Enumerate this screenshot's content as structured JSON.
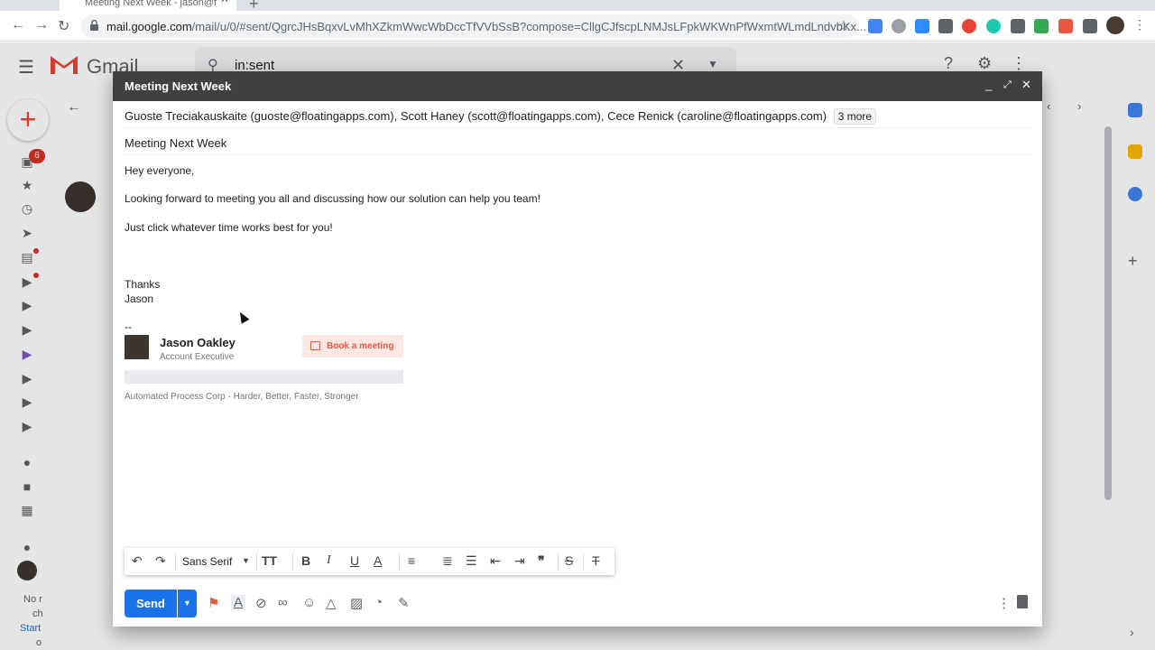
{
  "browser": {
    "tab_title": "Meeting Next Week - jason@f",
    "url_host": "mail.google.com",
    "url_path": "/mail/u/0/#sent/QgrcJHsBqxvLvMhXZkmWwcWbDccTfVVbSsB?compose=CllgCJfscpLNMJsLFpkWKWnPfWxmtWLmdLndvbKx..."
  },
  "gmail": {
    "logo_text": "Gmail",
    "search_value": "in:sent",
    "inbox_count": "6",
    "sidebar_bottom_text1": "No r",
    "sidebar_bottom_text2": "ch",
    "sidebar_bottom_link": "Start",
    "sidebar_bottom_text3": "o"
  },
  "compose": {
    "title": "Meeting Next Week",
    "recipients": "Guoste Treciakauskaite (guoste@floatingapps.com), Scott Haney (scott@floatingapps.com), Cece Renick (caroline@floatingapps.com)",
    "more_recipients": "3 more",
    "subject": "Meeting Next Week",
    "body": {
      "greeting": "Hey everyone,",
      "line1": "Looking forward to meeting you all and discussing how our solution can help you team!",
      "line2": "Just click whatever time works best for you!",
      "closing1": "Thanks",
      "closing2": "Jason",
      "sig_separator": "--"
    },
    "signature": {
      "name": "Jason Oakley",
      "title": "Account Executive",
      "book_button": "Book a meeting",
      "company": "Automated Process Corp - Harder, Better, Faster, Stronger"
    },
    "toolbar": {
      "font": "Sans Serif"
    },
    "send_label": "Send"
  },
  "colors": {
    "send_blue": "#1a73e8",
    "compose_header": "#404040",
    "book_accent": "#e8573f"
  }
}
